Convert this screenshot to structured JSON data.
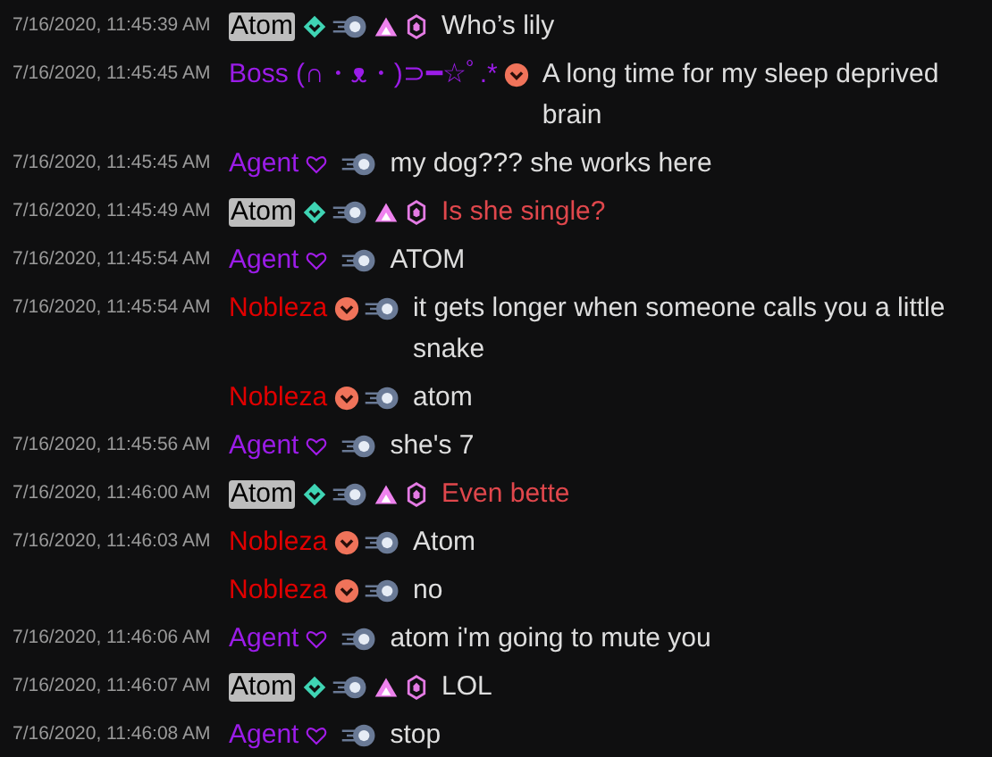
{
  "messages": [
    {
      "time": "7/16/2020, 11:45:39 AM",
      "user": "Atom",
      "color": "#000000",
      "badges": [
        {
          "kind": "diamond"
        },
        {
          "kind": "comet"
        },
        {
          "kind": "triangle"
        },
        {
          "kind": "gem"
        }
      ],
      "text": "Who’s lily",
      "highlighted": false
    },
    {
      "time": "7/16/2020, 11:45:45 AM",
      "user": "Boss (∩・ᴥ・)⊃━☆ﾟ.*",
      "color": "#9b1ce8",
      "badges": [
        {
          "kind": "chevron"
        }
      ],
      "text": "A long time for my sleep deprived brain",
      "highlighted": false
    },
    {
      "time": "7/16/2020, 11:45:45 AM",
      "user": "Agent",
      "color": "#9b1ce8",
      "badges": [
        {
          "kind": "heart"
        },
        {
          "kind": "comet"
        }
      ],
      "text": "my dog??? she works here",
      "highlighted": false
    },
    {
      "time": "7/16/2020, 11:45:49 AM",
      "user": "Atom",
      "color": "#000000",
      "badges": [
        {
          "kind": "diamond"
        },
        {
          "kind": "comet"
        },
        {
          "kind": "triangle"
        },
        {
          "kind": "gem"
        }
      ],
      "text": "Is she single?",
      "highlighted": true
    },
    {
      "time": "7/16/2020, 11:45:54 AM",
      "user": "Agent",
      "color": "#9b1ce8",
      "badges": [
        {
          "kind": "heart"
        },
        {
          "kind": "comet"
        }
      ],
      "text": "ATOM",
      "highlighted": false
    },
    {
      "time": "7/16/2020, 11:45:54 AM",
      "user": "Nobleza",
      "color": "#e00000",
      "badges": [
        {
          "kind": "chevron"
        },
        {
          "kind": "comet"
        }
      ],
      "text": "it gets longer when someone calls you a little snake",
      "highlighted": false
    },
    {
      "user": "Nobleza",
      "color": "#e00000",
      "badges": [
        {
          "kind": "chevron"
        },
        {
          "kind": "comet"
        }
      ],
      "text": "atom",
      "highlighted": false
    },
    {
      "time": "7/16/2020, 11:45:56 AM",
      "user": "Agent",
      "color": "#9b1ce8",
      "badges": [
        {
          "kind": "heart"
        },
        {
          "kind": "comet"
        }
      ],
      "text": "she's 7",
      "highlighted": false
    },
    {
      "time": "7/16/2020, 11:46:00 AM",
      "user": "Atom",
      "color": "#000000",
      "badges": [
        {
          "kind": "diamond"
        },
        {
          "kind": "comet"
        },
        {
          "kind": "triangle"
        },
        {
          "kind": "gem"
        }
      ],
      "text": "Even bette",
      "highlighted": true
    },
    {
      "time": "7/16/2020, 11:46:03 AM",
      "user": "Nobleza",
      "color": "#e00000",
      "badges": [
        {
          "kind": "chevron"
        },
        {
          "kind": "comet"
        }
      ],
      "text": "Atom",
      "highlighted": false
    },
    {
      "user": "Nobleza",
      "color": "#e00000",
      "badges": [
        {
          "kind": "chevron"
        },
        {
          "kind": "comet"
        }
      ],
      "text": "no",
      "highlighted": false
    },
    {
      "time": "7/16/2020, 11:46:06 AM",
      "user": "Agent",
      "color": "#9b1ce8",
      "badges": [
        {
          "kind": "heart"
        },
        {
          "kind": "comet"
        }
      ],
      "text": "atom i'm going to mute you",
      "highlighted": false
    },
    {
      "time": "7/16/2020, 11:46:07 AM",
      "user": "Atom",
      "color": "#000000",
      "badges": [
        {
          "kind": "diamond"
        },
        {
          "kind": "comet"
        },
        {
          "kind": "triangle"
        },
        {
          "kind": "gem"
        }
      ],
      "text": "LOL",
      "highlighted": false
    },
    {
      "time": "7/16/2020, 11:46:08 AM",
      "user": "Agent",
      "color": "#9b1ce8",
      "badges": [
        {
          "kind": "heart"
        },
        {
          "kind": "comet"
        }
      ],
      "text": "stop",
      "highlighted": false
    }
  ]
}
